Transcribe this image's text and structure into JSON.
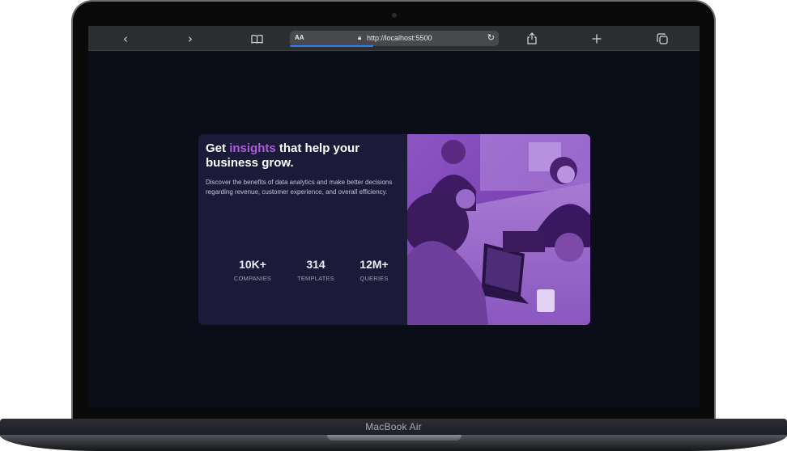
{
  "device": {
    "label": "MacBook Air"
  },
  "browser": {
    "text_size_label": "AA",
    "url": "http://localhost:5500",
    "icons": [
      "back-icon",
      "forward-icon",
      "bookmarks-icon",
      "lock-icon",
      "reload-icon",
      "share-icon",
      "new-tab-icon",
      "tabs-icon"
    ]
  },
  "card": {
    "headline_start": "Get ",
    "headline_accent": "insights",
    "headline_end": " that help your business grow.",
    "description": "Discover the benefits of data analytics and make better decisions regarding revenue, customer experience, and overall efficiency.",
    "stats": [
      {
        "value": "10K+",
        "label": "COMPANIES"
      },
      {
        "value": "314",
        "label": "TEMPLATES"
      },
      {
        "value": "12M+",
        "label": "QUERIES"
      }
    ],
    "accent_color": "#ab5cdb",
    "background_color": "#1c1a39",
    "image": "office-team-photo-purple-overlay"
  }
}
